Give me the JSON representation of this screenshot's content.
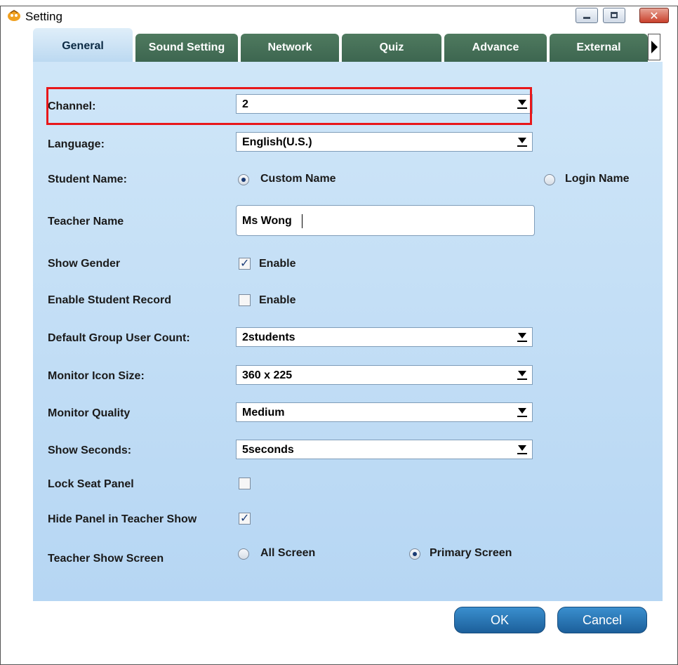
{
  "window": {
    "title": "Setting"
  },
  "tabs": [
    {
      "label": "General"
    },
    {
      "label": "Sound Setting"
    },
    {
      "label": "Network"
    },
    {
      "label": "Quiz"
    },
    {
      "label": "Advance"
    },
    {
      "label": "External"
    }
  ],
  "form": {
    "channel": {
      "label": "Channel:",
      "value": "2"
    },
    "language": {
      "label": "Language:",
      "value": "English(U.S.)"
    },
    "student_name": {
      "label": "Student Name:",
      "option_custom": "Custom Name",
      "option_login": "Login Name",
      "selected": "Custom Name"
    },
    "teacher_name": {
      "label": "Teacher Name",
      "value": "Ms Wong"
    },
    "show_gender": {
      "label": "Show Gender",
      "option": "Enable",
      "checked": true
    },
    "enable_student_record": {
      "label": "Enable Student Record",
      "option": "Enable",
      "checked": false
    },
    "default_group_user_count": {
      "label": "Default Group User Count:",
      "value": "2students"
    },
    "monitor_icon_size": {
      "label": "Monitor Icon Size:",
      "value": "360 x 225"
    },
    "monitor_quality": {
      "label": "Monitor Quality",
      "value": "Medium"
    },
    "show_seconds": {
      "label": "Show Seconds:",
      "value": "5seconds"
    },
    "lock_seat_panel": {
      "label": "Lock Seat Panel",
      "checked": false
    },
    "hide_panel_in_teacher_show": {
      "label": "Hide Panel in Teacher Show",
      "checked": true
    },
    "teacher_show_screen": {
      "label": "Teacher Show Screen",
      "option_all": "All Screen",
      "option_primary": "Primary Screen",
      "selected": "Primary Screen"
    }
  },
  "buttons": {
    "ok": "OK",
    "cancel": "Cancel"
  },
  "colors": {
    "highlight": "#e8171a",
    "tab_inactive": "#3d6650",
    "panel": "#b6d6f3",
    "button": "#1c5f9b"
  }
}
